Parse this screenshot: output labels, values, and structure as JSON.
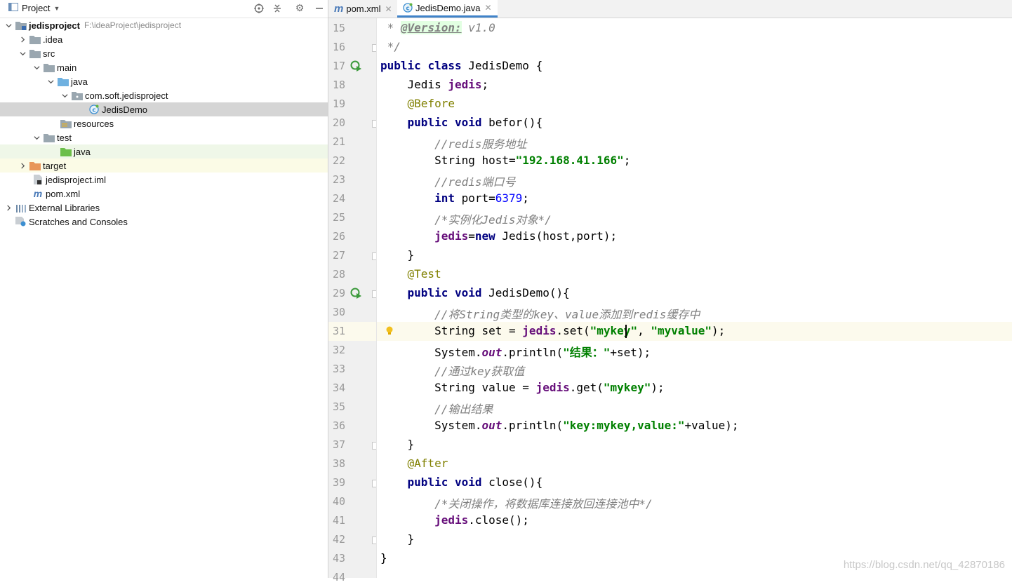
{
  "project_panel": {
    "title": "Project",
    "tree": [
      {
        "label": "jedisproject",
        "path": "F:\\ideaProject\\jedisproject",
        "icon": "module-folder-icon",
        "expanded": true
      },
      {
        "label": ".idea",
        "icon": "folder-icon",
        "expanded": false
      },
      {
        "label": "src",
        "icon": "folder-icon",
        "expanded": true
      },
      {
        "label": "main",
        "icon": "folder-icon",
        "expanded": true
      },
      {
        "label": "java",
        "icon": "source-root-folder-icon",
        "expanded": true
      },
      {
        "label": "com.soft.jedisproject",
        "icon": "package-icon",
        "expanded": true
      },
      {
        "label": "JedisDemo",
        "icon": "java-class-icon",
        "selected": true
      },
      {
        "label": "resources",
        "icon": "resources-folder-icon"
      },
      {
        "label": "test",
        "icon": "folder-icon",
        "expanded": true
      },
      {
        "label": "java",
        "icon": "test-root-folder-icon"
      },
      {
        "label": "target",
        "icon": "excluded-folder-icon",
        "expanded": false
      },
      {
        "label": "jedisproject.iml",
        "icon": "iml-file-icon"
      },
      {
        "label": "pom.xml",
        "icon": "maven-file-icon"
      },
      {
        "label": "External Libraries",
        "icon": "libraries-icon",
        "expanded": false
      },
      {
        "label": "Scratches and Consoles",
        "icon": "scratches-icon"
      }
    ]
  },
  "tabs": [
    {
      "label": "pom.xml",
      "icon": "maven-file-icon"
    },
    {
      "label": "JedisDemo.java",
      "icon": "java-class-icon",
      "active": true
    }
  ],
  "editor": {
    "current_line": 31,
    "lines": [
      {
        "n": "15",
        "t": " * @Version: v1.0"
      },
      {
        "n": "16",
        "t": " */"
      },
      {
        "n": "17",
        "t": "public class JedisDemo {"
      },
      {
        "n": "18",
        "t": "    Jedis jedis;"
      },
      {
        "n": "19",
        "t": "    @Before"
      },
      {
        "n": "20",
        "t": "    public void befor(){"
      },
      {
        "n": "21",
        "t": "        //redis服务地址"
      },
      {
        "n": "22",
        "t": "        String host=\"192.168.41.166\";"
      },
      {
        "n": "23",
        "t": "        //redis端口号"
      },
      {
        "n": "24",
        "t": "        int port=6379;"
      },
      {
        "n": "25",
        "t": "        /*实例化Jedis对象*/"
      },
      {
        "n": "26",
        "t": "        jedis=new Jedis(host,port);"
      },
      {
        "n": "27",
        "t": "    }"
      },
      {
        "n": "28",
        "t": "    @Test"
      },
      {
        "n": "29",
        "t": "    public void JedisDemo(){"
      },
      {
        "n": "30",
        "t": "        //将String类型的key、value添加到redis缓存中"
      },
      {
        "n": "31",
        "t": "        String set = jedis.set(\"mykey\", \"myvalue\");"
      },
      {
        "n": "32",
        "t": "        System.out.println(\"结果：\"+set);"
      },
      {
        "n": "33",
        "t": "        //通过key获取值"
      },
      {
        "n": "34",
        "t": "        String value = jedis.get(\"mykey\");"
      },
      {
        "n": "35",
        "t": "        //输出结果"
      },
      {
        "n": "36",
        "t": "        System.out.println(\"key:mykey,value:\"+value);"
      },
      {
        "n": "37",
        "t": "    }"
      },
      {
        "n": "38",
        "t": "    @After"
      },
      {
        "n": "39",
        "t": "    public void close(){"
      },
      {
        "n": "40",
        "t": "        /*关闭操作，将数据库连接放回连接池中*/"
      },
      {
        "n": "41",
        "t": "        jedis.close();"
      },
      {
        "n": "42",
        "t": "    }"
      },
      {
        "n": "43",
        "t": "}"
      },
      {
        "n": "44",
        "t": ""
      }
    ]
  },
  "watermark": "https://blog.csdn.net/qq_42870186",
  "colors": {
    "keyword": "#000080",
    "string": "#008000",
    "number": "#0000ff",
    "comment": "#808080",
    "annotation": "#808000",
    "field": "#660e7a",
    "selection": "#d5d5d5",
    "current_line": "#fcfaed",
    "tab_underline": "#4083c9"
  }
}
